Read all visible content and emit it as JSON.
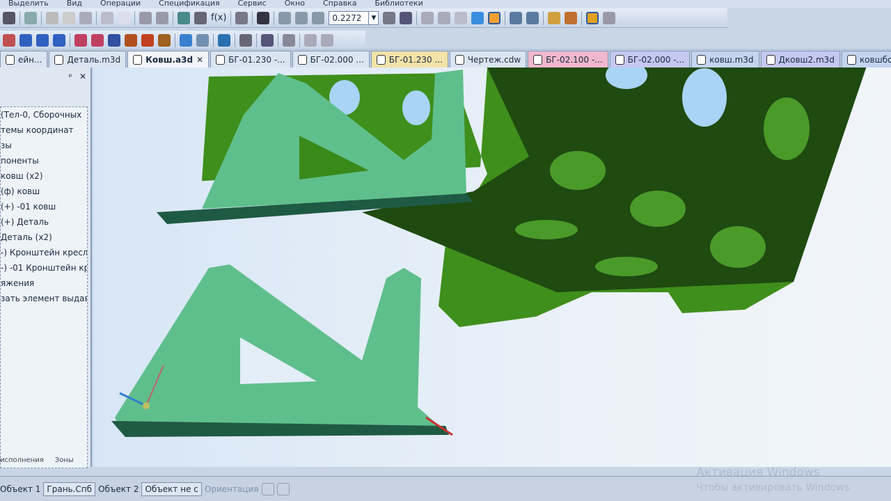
{
  "menu": [
    "Выделить",
    "Вид",
    "Операции",
    "Спецификация",
    "Сервис",
    "Окно",
    "Справка",
    "Библиотеки"
  ],
  "toolbar": {
    "zoom_value": "0.2272",
    "fx_label": "f(x)"
  },
  "tabs": [
    {
      "label": "ейн...",
      "color": "#dbe5f2"
    },
    {
      "label": "Деталь.m3d",
      "color": "#dbe5f2"
    },
    {
      "label": "Ковш.a3d",
      "color": "#f2f6fb",
      "active": true
    },
    {
      "label": "БГ-01.230 -...",
      "color": "#dbe5f2"
    },
    {
      "label": "БГ-02.000 ...",
      "color": "#dbe5f2"
    },
    {
      "label": "БГ-01.230 ...",
      "color": "#f3e3a8"
    },
    {
      "label": "Чертеж.cdw",
      "color": "#dbe5f2"
    },
    {
      "label": "БГ-02.100 -...",
      "color": "#f0b8cc"
    },
    {
      "label": "БГ-02.000 -...",
      "color": "#c5c8f0"
    },
    {
      "label": "ковш.m3d",
      "color": "#c4d4f0"
    },
    {
      "label": "Дковш2.m3d",
      "color": "#c5c8f0"
    },
    {
      "label": "ковшбок - ...",
      "color": "#c4d4f0"
    }
  ],
  "panel": {
    "pin": "ᵖ",
    "close": "✕",
    "tree": [
      "(Тел-0, Сборочных",
      "темы координат",
      "зы",
      "поненты",
      "ковш (x2)",
      "(ф) ковш",
      "(+) -01 ковш",
      "(+) Деталь",
      "Деталь (x2)",
      "-) Кронштейн кресл",
      "-) -01 Кронштейн кр",
      "яжения",
      "зать элемент выдав"
    ],
    "bottom_tabs": [
      "исполнения",
      "Зоны"
    ]
  },
  "status": {
    "obj1_label": "Объект 1",
    "obj1_value": "Грань.Спб",
    "obj2_label": "Объект 2",
    "obj2_value": "Объект не с",
    "orientation": "Ориентация"
  },
  "watermark": [
    "Активация Windows",
    "Чтобы активировать Windows"
  ]
}
